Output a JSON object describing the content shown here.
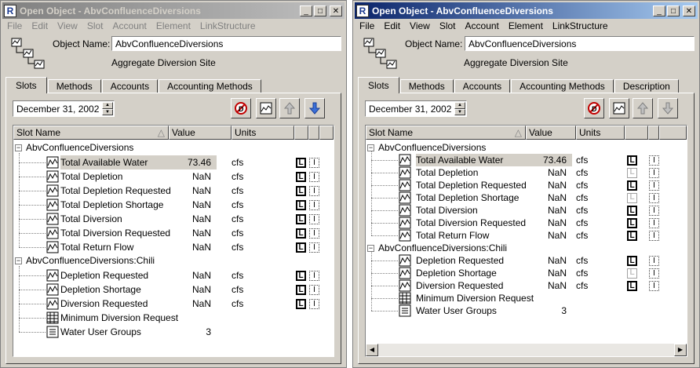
{
  "windows": [
    {
      "title": "Open Object - AbvConfluenceDiversions",
      "menu": [
        "File",
        "Edit",
        "View",
        "Slot",
        "Account",
        "Element",
        "LinkStructure"
      ],
      "object_name_label": "Object Name:",
      "object_name": "AbvConfluenceDiversions",
      "object_type": "Aggregate Diversion Site",
      "tabs": [
        "Slots",
        "Methods",
        "Accounts",
        "Accounting Methods"
      ],
      "date": "December 31, 2002",
      "columns": [
        "Slot Name",
        "Value",
        "Units"
      ],
      "groups": [
        {
          "label": "AbvConfluenceDiversions",
          "slots": [
            {
              "name": "Total Available Water",
              "value": "73.46",
              "units": "cfs"
            },
            {
              "name": "Total Depletion",
              "value": "NaN",
              "units": "cfs"
            },
            {
              "name": "Total Depletion Requested",
              "value": "NaN",
              "units": "cfs"
            },
            {
              "name": "Total Depletion Shortage",
              "value": "NaN",
              "units": "cfs"
            },
            {
              "name": "Total Diversion",
              "value": "NaN",
              "units": "cfs"
            },
            {
              "name": "Total Diversion Requested",
              "value": "NaN",
              "units": "cfs"
            },
            {
              "name": "Total Return Flow",
              "value": "NaN",
              "units": "cfs"
            }
          ]
        },
        {
          "label": "AbvConfluenceDiversions:Chili",
          "slots": [
            {
              "name": "Depletion Requested",
              "value": "NaN",
              "units": "cfs"
            },
            {
              "name": "Depletion Shortage",
              "value": "NaN",
              "units": "cfs"
            },
            {
              "name": "Diversion Requested",
              "value": "NaN",
              "units": "cfs"
            },
            {
              "name": "Minimum Diversion Request",
              "value": "",
              "units": ""
            },
            {
              "name": "Water User Groups",
              "value": "3",
              "units": ""
            }
          ]
        }
      ]
    },
    {
      "title": "Open Object - AbvConfluenceDiversions",
      "menu": [
        "File",
        "Edit",
        "View",
        "Slot",
        "Account",
        "Element",
        "LinkStructure"
      ],
      "object_name_label": "Object Name:",
      "object_name": "AbvConfluenceDiversions",
      "object_type": "Aggregate Diversion Site",
      "tabs": [
        "Slots",
        "Methods",
        "Accounts",
        "Accounting Methods",
        "Description"
      ],
      "date": "December 31, 2002",
      "columns": [
        "Slot Name",
        "Value",
        "Units"
      ],
      "groups": [
        {
          "label": "AbvConfluenceDiversions",
          "slots": [
            {
              "name": "Total Available Water",
              "value": "73.46",
              "units": "cfs"
            },
            {
              "name": "Total Depletion",
              "value": "NaN",
              "units": "cfs"
            },
            {
              "name": "Total Depletion Requested",
              "value": "NaN",
              "units": "cfs"
            },
            {
              "name": "Total Depletion Shortage",
              "value": "NaN",
              "units": "cfs"
            },
            {
              "name": "Total Diversion",
              "value": "NaN",
              "units": "cfs"
            },
            {
              "name": "Total Diversion Requested",
              "value": "NaN",
              "units": "cfs"
            },
            {
              "name": "Total Return Flow",
              "value": "NaN",
              "units": "cfs"
            }
          ]
        },
        {
          "label": "AbvConfluenceDiversions:Chili",
          "slots": [
            {
              "name": "Depletion Requested",
              "value": "NaN",
              "units": "cfs"
            },
            {
              "name": "Depletion Shortage",
              "value": "NaN",
              "units": "cfs"
            },
            {
              "name": "Diversion Requested",
              "value": "NaN",
              "units": "cfs"
            },
            {
              "name": "Minimum Diversion Request",
              "value": "",
              "units": ""
            },
            {
              "name": "Water User Groups",
              "value": "3",
              "units": ""
            }
          ]
        }
      ]
    }
  ]
}
